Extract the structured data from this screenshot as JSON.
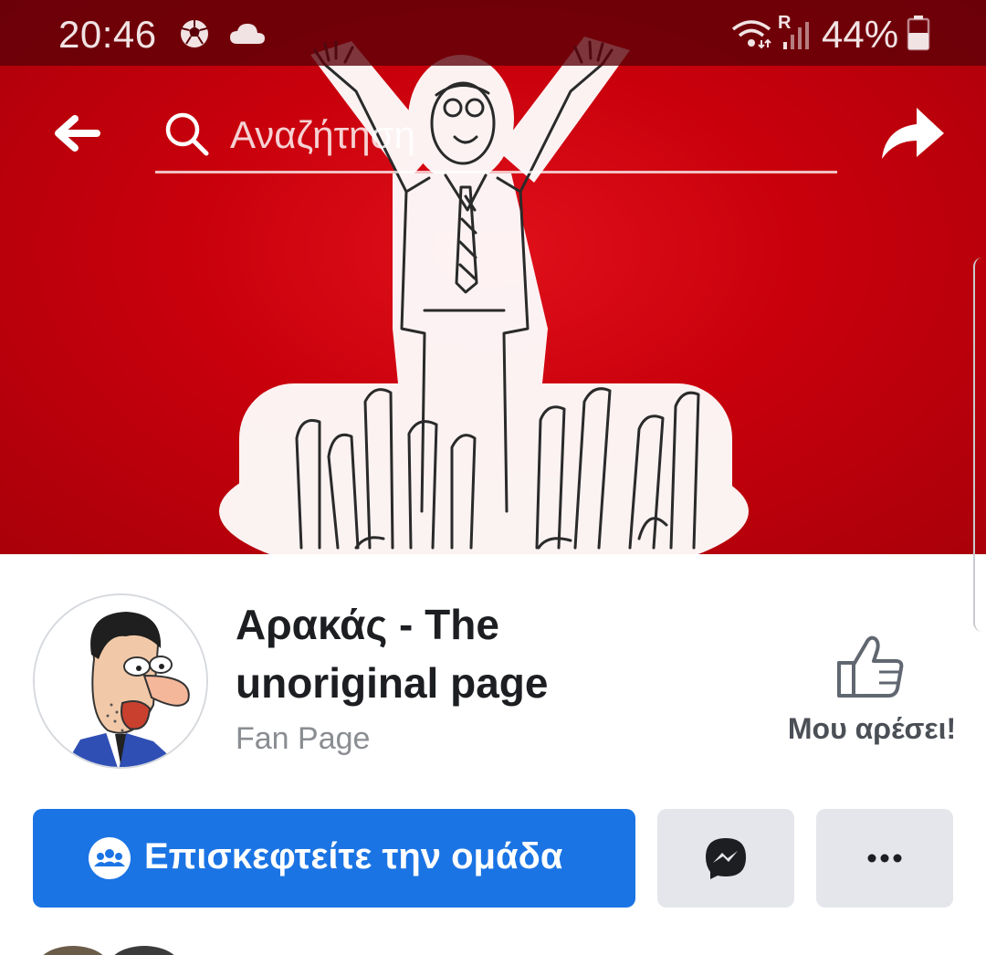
{
  "status_bar": {
    "time": "20:46",
    "icons": [
      "soccer-ball-icon",
      "cloud-icon",
      "wifi-icon",
      "signal-icon",
      "battery-icon"
    ],
    "roaming_label": "R",
    "battery": "44%"
  },
  "app_bar": {
    "back_icon": "arrow-left-icon",
    "search_placeholder": "Αναζήτηση",
    "share_icon": "share-arrow-icon"
  },
  "page": {
    "name": "Αρακάς - The unoriginal page",
    "category": "Fan Page",
    "like_label": "Μου αρέσει!"
  },
  "actions": {
    "visit_group_label": "Επισκεφτείτε την ομάδα",
    "visit_group_icon": "group-icon",
    "messenger_icon": "messenger-icon",
    "more_icon": "more-dots-icon"
  },
  "colors": {
    "cover_red": "#c8000c",
    "primary_blue": "#1b74e4",
    "secondary_button": "#e4e6eb",
    "muted_text": "#8a8d91"
  }
}
